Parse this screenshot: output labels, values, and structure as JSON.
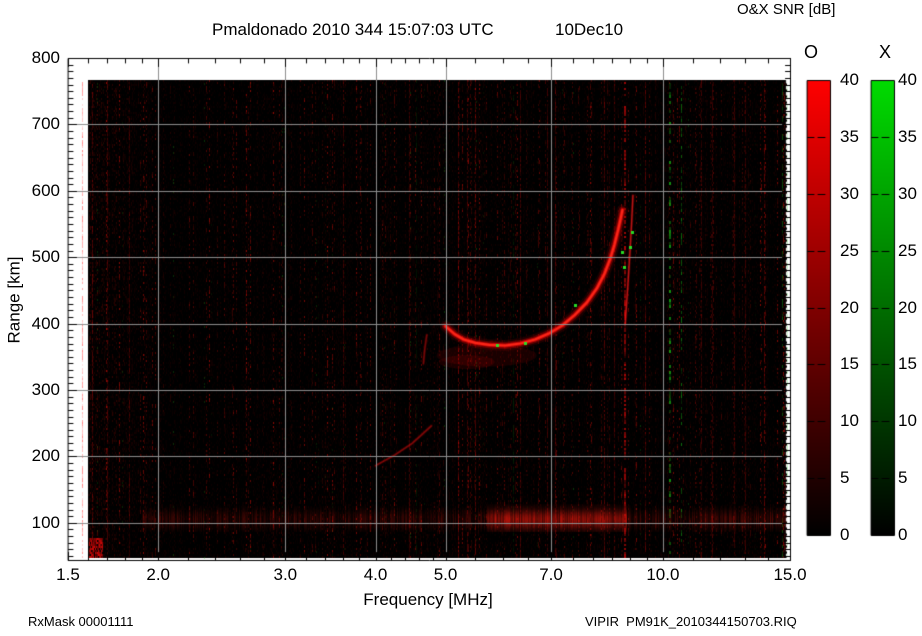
{
  "header": {
    "title": "Pmaldonado 2010 344 15:07:03 UTC",
    "date": "10Dec10",
    "colorbar_title": "O&X SNR [dB]"
  },
  "footer": {
    "rx_mask": "RxMask 00001111",
    "file_name": "VIPIR  PM91K_2010344150703.RIQ"
  },
  "chart_data": {
    "type": "heatmap",
    "title": "Pmaldonado 2010 344 15:07:03 UTC",
    "subtitle": "10Dec10",
    "xlabel": "Frequency [MHz]",
    "ylabel": "Range [km]",
    "x_scale": "log",
    "xlim": [
      1.5,
      15.0
    ],
    "ylim": [
      44,
      800
    ],
    "x_ticks": [
      1.5,
      2.0,
      3.0,
      4.0,
      5.0,
      7.0,
      10.0,
      15.0
    ],
    "x_tick_labels": [
      "1.5",
      "2.0",
      "3.0",
      "4.0",
      "5.0",
      "7.0",
      "10.0",
      "15.0"
    ],
    "x_minor_ticks": [
      1.6,
      1.7,
      1.8,
      1.9,
      2.2,
      2.4,
      2.6,
      2.8,
      3.2,
      3.4,
      3.6,
      3.8,
      4.2,
      4.4,
      4.6,
      4.8,
      5.5,
      6.0,
      6.5,
      7.5,
      8.0,
      8.5,
      9.0,
      9.5,
      11.0,
      12.0,
      13.0,
      14.0
    ],
    "y_ticks": [
      100,
      200,
      300,
      400,
      500,
      600,
      700,
      800
    ],
    "y_tick_labels": [
      "100",
      "200",
      "300",
      "400",
      "500",
      "600",
      "700",
      "800"
    ],
    "y_minor_tick_step": 10,
    "grid": true,
    "grid_color": "#8d8d8d",
    "background_color": "#000000",
    "colorbars": [
      {
        "label": "O",
        "mode": "ordinary",
        "color_top": "#ff0000",
        "color_bottom": "#000000",
        "min": 0,
        "max": 40,
        "tick_step": 5,
        "unit": "dB",
        "tick_labels": [
          "40",
          "35",
          "30",
          "25",
          "20",
          "15",
          "10",
          "5",
          "0"
        ]
      },
      {
        "label": "X",
        "mode": "extraordinary",
        "color_top": "#00dc00",
        "color_bottom": "#000000",
        "min": 0,
        "max": 40,
        "tick_step": 5,
        "unit": "dB",
        "tick_labels": [
          "40",
          "35",
          "30",
          "25",
          "20",
          "15",
          "10",
          "5",
          "0"
        ]
      }
    ],
    "o_mode_trace": {
      "description": "Main F-layer O-mode echo trace, red, asymptotic near foF2 ~8.8 MHz",
      "points_mhz_km": [
        [
          5.0,
          396
        ],
        [
          5.15,
          384
        ],
        [
          5.3,
          376
        ],
        [
          5.5,
          371
        ],
        [
          5.75,
          368
        ],
        [
          6.05,
          367
        ],
        [
          6.35,
          370
        ],
        [
          6.65,
          376
        ],
        [
          6.95,
          385
        ],
        [
          7.25,
          397
        ],
        [
          7.55,
          413
        ],
        [
          7.85,
          432
        ],
        [
          8.1,
          453
        ],
        [
          8.3,
          475
        ],
        [
          8.45,
          497
        ],
        [
          8.57,
          519
        ],
        [
          8.67,
          541
        ],
        [
          8.74,
          558
        ],
        [
          8.79,
          571
        ]
      ]
    },
    "o_mode_second_echo": {
      "description": "Thin secondary echo just right of the asymptote",
      "points_mhz_km": [
        [
          8.87,
          400
        ],
        [
          8.94,
          455
        ],
        [
          9.0,
          505
        ],
        [
          9.05,
          550
        ],
        [
          9.09,
          593
        ]
      ]
    },
    "es_slant_echo": {
      "description": "Faint slanted echo segment near 4 MHz / 200 km",
      "points_mhz_km": [
        [
          4.0,
          186
        ],
        [
          4.25,
          202
        ],
        [
          4.5,
          220
        ],
        [
          4.78,
          246
        ]
      ]
    },
    "faint_echo_4p7": {
      "description": "Short faint vertical echo near 4.7 MHz",
      "points_mhz_km": [
        [
          4.66,
          340
        ],
        [
          4.68,
          362
        ],
        [
          4.71,
          383
        ]
      ]
    },
    "x_mode_specks_mhz_km": [
      [
        5.9,
        368
      ],
      [
        6.45,
        371
      ],
      [
        7.56,
        428
      ],
      [
        8.77,
        508
      ],
      [
        8.83,
        486
      ],
      [
        9.0,
        515
      ],
      [
        9.06,
        538
      ]
    ],
    "e_region_band": {
      "center_range_km": 105,
      "freq_span_mhz": [
        1.9,
        15.0
      ],
      "bright_span_mhz": [
        5.7,
        8.9
      ]
    },
    "rfi_stripes": [
      {
        "freq_mhz": 1.57,
        "color": "red",
        "strength": 0.5
      },
      {
        "freq_mhz": 1.62,
        "color": "red",
        "strength": 0.42
      },
      {
        "freq_mhz": 1.7,
        "color": "red",
        "strength": 0.3
      },
      {
        "freq_mhz": 1.82,
        "color": "red",
        "strength": 0.22
      },
      {
        "freq_mhz": 3.6,
        "color": "red",
        "strength": 0.28
      },
      {
        "freq_mhz": 4.45,
        "color": "red",
        "strength": 0.28
      },
      {
        "freq_mhz": 4.55,
        "color": "green",
        "strength": 0.12
      },
      {
        "freq_mhz": 5.2,
        "color": "red",
        "strength": 0.42
      },
      {
        "freq_mhz": 5.35,
        "color": "red",
        "strength": 0.35
      },
      {
        "freq_mhz": 5.5,
        "color": "red",
        "strength": 0.3
      },
      {
        "freq_mhz": 6.2,
        "color": "green",
        "strength": 0.15
      },
      {
        "freq_mhz": 6.35,
        "color": "red",
        "strength": 0.32
      },
      {
        "freq_mhz": 6.9,
        "color": "red",
        "strength": 0.28
      },
      {
        "freq_mhz": 7.1,
        "color": "red",
        "strength": 0.32
      },
      {
        "freq_mhz": 8.3,
        "color": "red",
        "strength": 0.38
      },
      {
        "freq_mhz": 8.55,
        "color": "red",
        "strength": 0.32
      },
      {
        "freq_mhz": 8.86,
        "color": "red",
        "strength": 0.65
      },
      {
        "freq_mhz": 9.45,
        "color": "red",
        "strength": 0.38
      },
      {
        "freq_mhz": 10.0,
        "color": "red",
        "strength": 0.55
      },
      {
        "freq_mhz": 10.22,
        "color": "green",
        "strength": 0.65
      },
      {
        "freq_mhz": 10.6,
        "color": "green",
        "strength": 0.5
      },
      {
        "freq_mhz": 11.3,
        "color": "red",
        "strength": 0.32
      },
      {
        "freq_mhz": 11.7,
        "color": "red",
        "strength": 0.28
      },
      {
        "freq_mhz": 12.55,
        "color": "red",
        "strength": 0.25
      },
      {
        "freq_mhz": 13.0,
        "color": "red",
        "strength": 0.3
      },
      {
        "freq_mhz": 13.8,
        "color": "red",
        "strength": 0.45
      },
      {
        "freq_mhz": 14.6,
        "color": "green",
        "strength": 0.35
      },
      {
        "freq_mhz": 14.85,
        "color": "green",
        "strength": 0.3
      }
    ],
    "noise": {
      "seed": 1337,
      "description": "sparse dark-red receiver noise columns over black, occasional faint green specks"
    }
  }
}
